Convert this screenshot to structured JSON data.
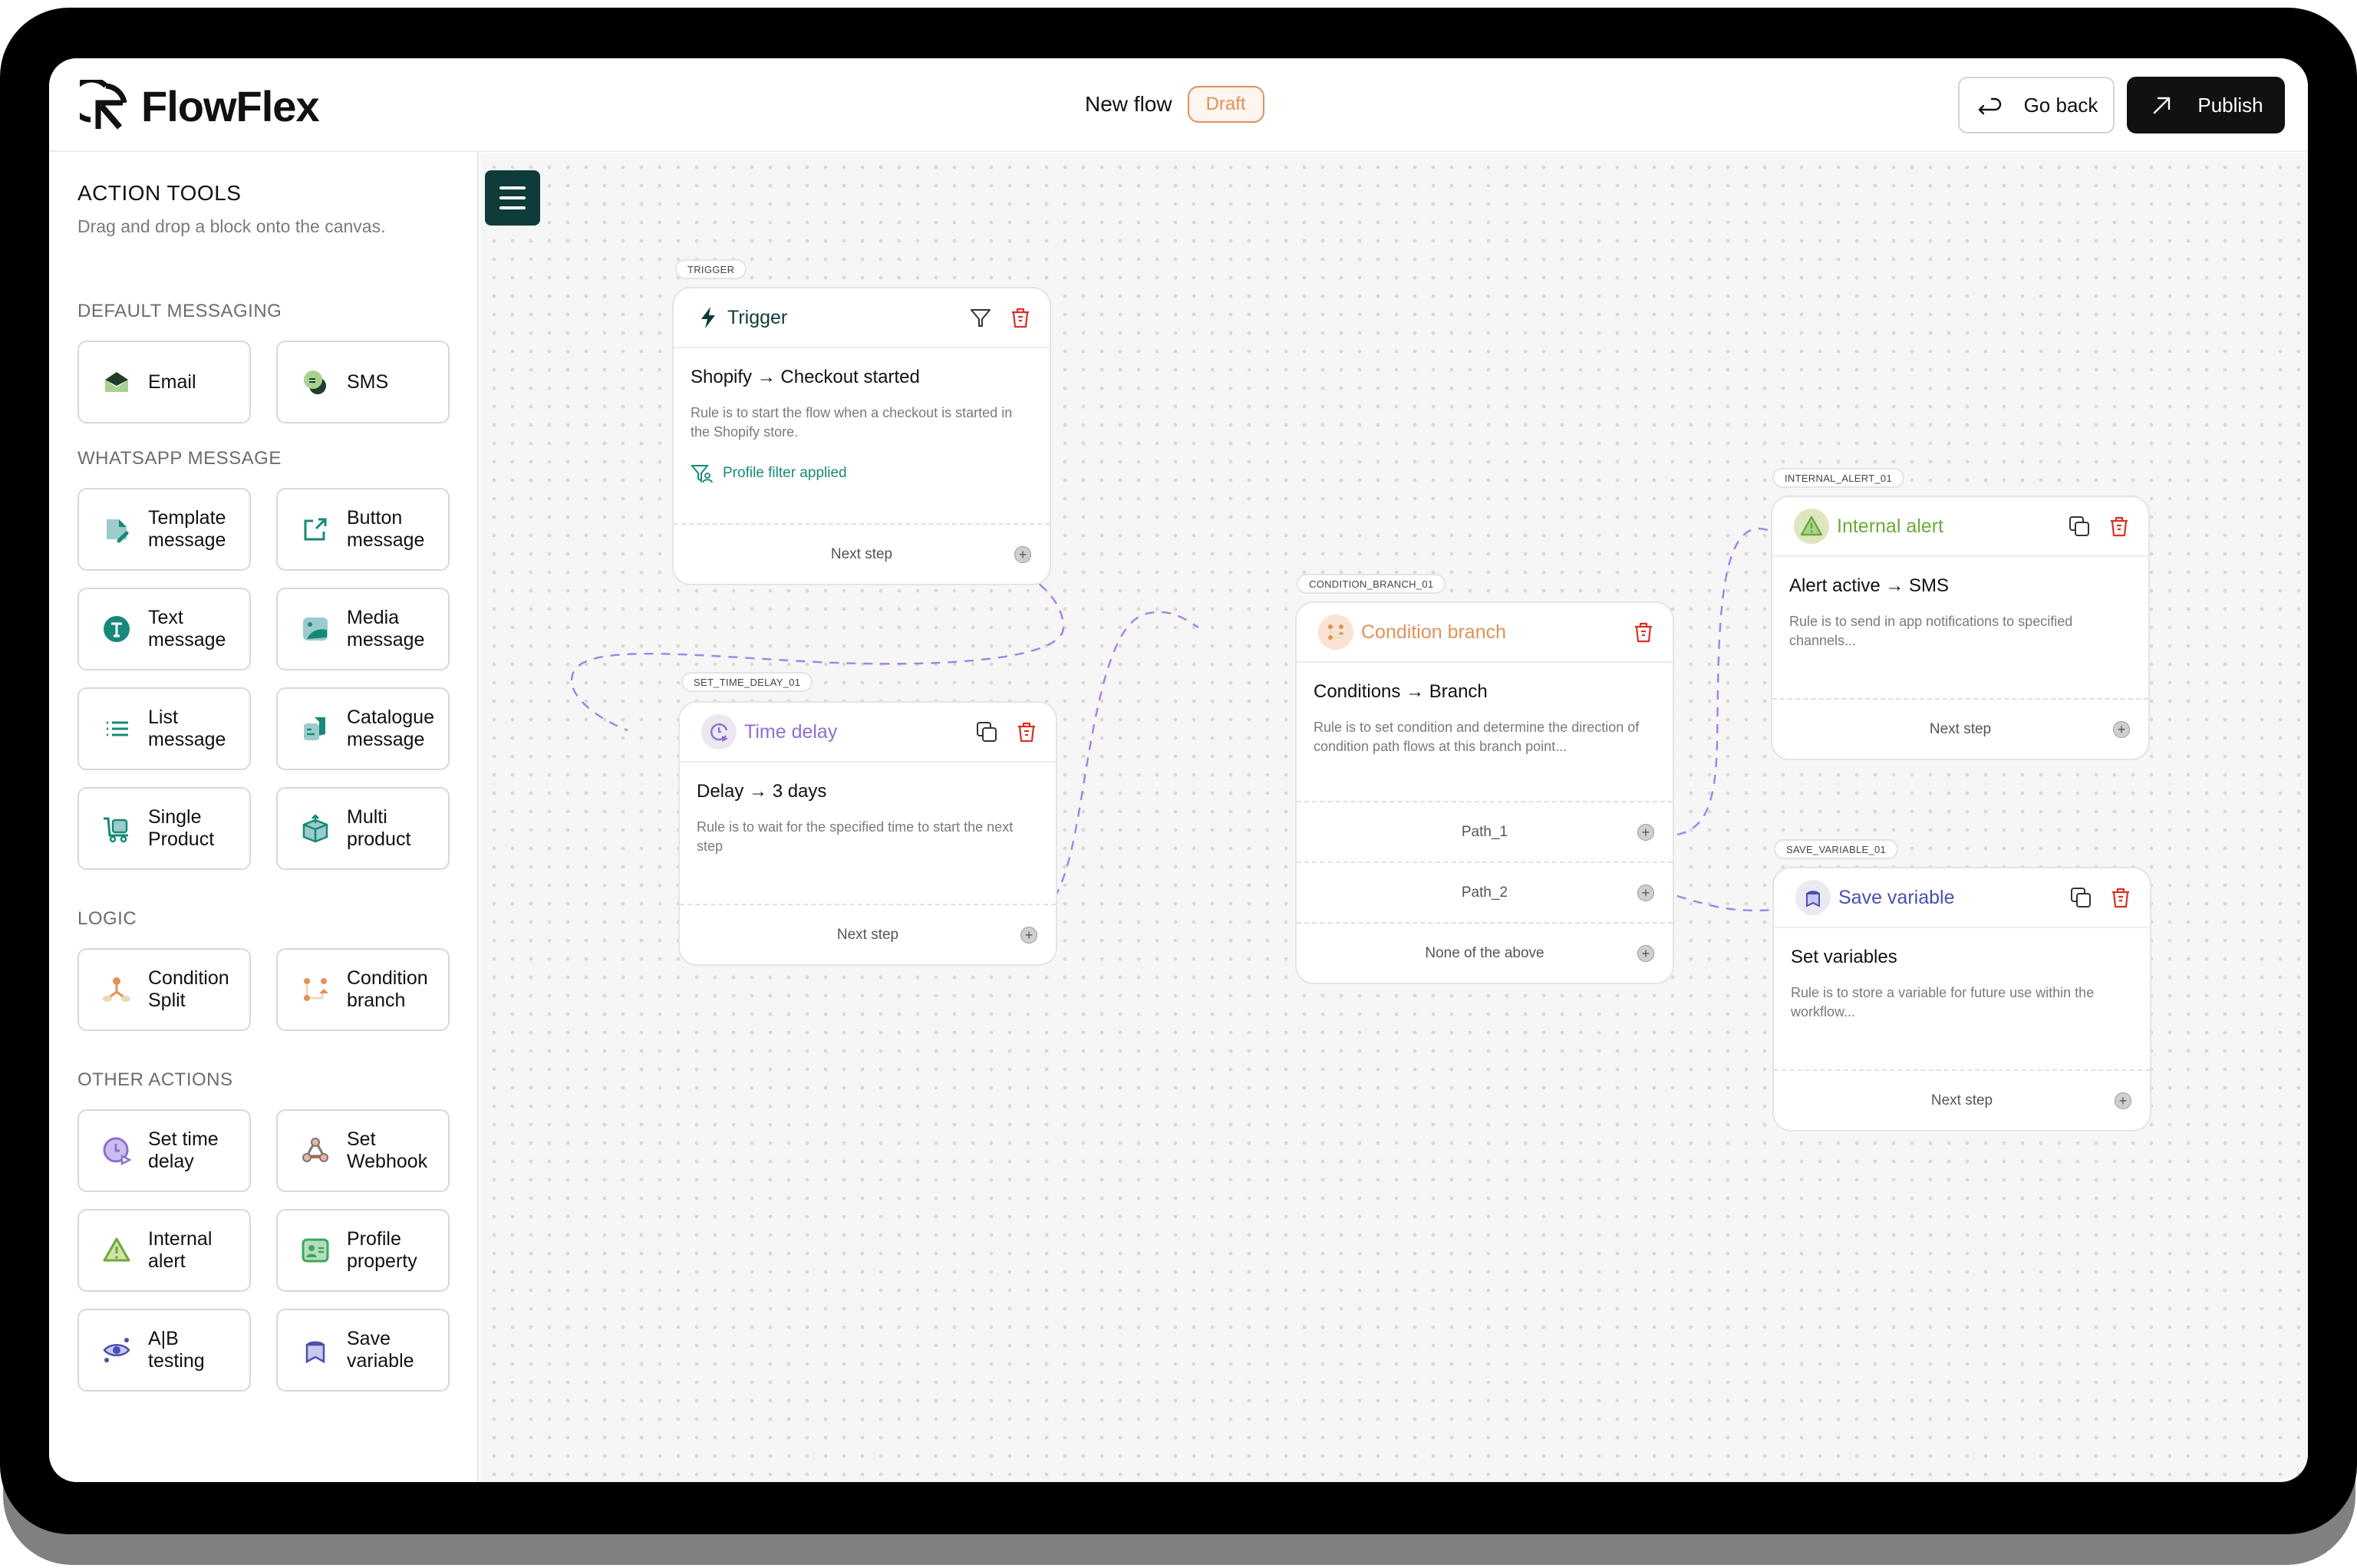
{
  "app": {
    "name": "FlowFlex"
  },
  "header": {
    "flow_title": "New flow",
    "status_badge": "Draft",
    "go_back_label": "Go back",
    "publish_label": "Publish"
  },
  "sidebar": {
    "title": "ACTION TOOLS",
    "subtitle": "Drag and drop a block onto the canvas.",
    "sections": [
      {
        "title": "DEFAULT MESSAGING",
        "items": [
          {
            "label": "Email",
            "icon": "email-icon"
          },
          {
            "label": "SMS",
            "icon": "sms-icon"
          }
        ]
      },
      {
        "title": "WHATSAPP MESSAGE",
        "items": [
          {
            "label": "Template\nmessage",
            "icon": "template-message-icon"
          },
          {
            "label": "Button\nmessage",
            "icon": "button-message-icon"
          },
          {
            "label": "Text\nmessage",
            "icon": "text-message-icon"
          },
          {
            "label": "Media\nmessage",
            "icon": "media-message-icon"
          },
          {
            "label": "List\nmessage",
            "icon": "list-message-icon"
          },
          {
            "label": "Catalogue\nmessage",
            "icon": "catalogue-message-icon"
          },
          {
            "label": "Single\nProduct",
            "icon": "cart-icon"
          },
          {
            "label": "Multi\nproduct",
            "icon": "box-icon"
          }
        ]
      },
      {
        "title": "LOGIC",
        "items": [
          {
            "label": "Condition\nSplit",
            "icon": "condition-split-icon"
          },
          {
            "label": "Condition\nbranch",
            "icon": "condition-branch-icon"
          }
        ]
      },
      {
        "title": "OTHER ACTIONS",
        "items": [
          {
            "label": "Set time\ndelay",
            "icon": "clock-icon"
          },
          {
            "label": "Set\nWebhook",
            "icon": "webhook-icon"
          },
          {
            "label": "Internal\nalert",
            "icon": "alert-icon"
          },
          {
            "label": "Profile\nproperty",
            "icon": "profile-property-icon"
          },
          {
            "label": "A|B\ntesting",
            "icon": "ab-testing-icon"
          },
          {
            "label": "Save\nvariable",
            "icon": "bookmark-icon"
          }
        ]
      }
    ]
  },
  "canvas": {
    "nodes": {
      "trigger": {
        "tag": "TRIGGER",
        "title": "Trigger",
        "rule": "Shopify  → Checkout started",
        "description": "Rule is to start the flow when a checkout is started in the Shopify store.",
        "filter_note": "Profile filter applied",
        "footer": "Next step",
        "color": "#0f3b3a"
      },
      "time_delay": {
        "tag": "SET_TIME_DELAY_01",
        "title": "Time delay",
        "rule": "Delay  → 3 days",
        "description": "Rule is to wait for the specified time to start the next step",
        "footer": "Next step",
        "color": "#8d6fd1"
      },
      "condition_branch": {
        "tag": "CONDITION_BRANCH_01",
        "title": "Condition branch",
        "rule": "Conditions → Branch",
        "description": "Rule is to set condition and determine the direction of condition path flows at this branch point...",
        "paths": [
          "Path_1",
          "Path_2",
          "None of the above"
        ],
        "color": "#e0925a"
      },
      "internal_alert": {
        "tag": "INTERNAL_ALERT_01",
        "title": "Internal alert",
        "rule": "Alert active  → SMS",
        "description": "Rule is to send in app notifications to specified channels...",
        "footer": "Next step",
        "color": "#6aaa3a"
      },
      "save_variable": {
        "tag": "SAVE_VARIABLE_01",
        "title": "Save variable",
        "rule": "Set variables",
        "description": "Rule is to store a variable for future use within the workflow...",
        "footer": "Next step",
        "color": "#4b4fb0"
      }
    },
    "connector_color": "#a77fe8",
    "delete_color": "#d93025"
  }
}
